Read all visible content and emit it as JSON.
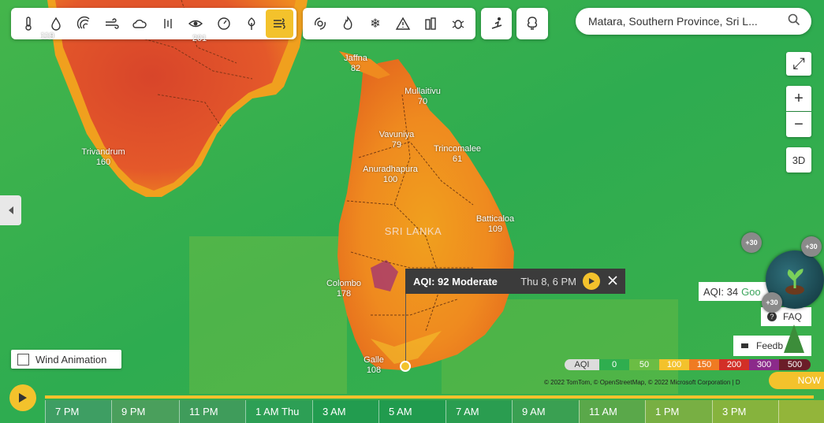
{
  "toolbar": {
    "weather_layers": [
      "thermometer-icon",
      "humidity-drop-icon",
      "wind-swirl-icon",
      "wind-icon",
      "cloud-icon",
      "precipitation-icon",
      "visibility-eye-icon",
      "pressure-gauge-icon",
      "pollen-leaf-icon",
      "air-quality-icon"
    ],
    "active_layer": "air-quality-icon",
    "hazards": [
      "hurricane-icon",
      "wildfire-icon",
      "winter-storm-icon",
      "warning-icon",
      "buildings-icon",
      "bug-icon"
    ]
  },
  "search": {
    "value": "Matara, Southern Province, Sri L..."
  },
  "controls": {
    "expand": "⤢",
    "zoom_in": "+",
    "zoom_out": "−",
    "three_d": "3D"
  },
  "map": {
    "country_label": "SRI LANKA",
    "cities": [
      {
        "name": "",
        "value": "119"
      },
      {
        "name": "",
        "value": "201"
      },
      {
        "name": "Jaffna",
        "value": "82"
      },
      {
        "name": "Mullaitivu",
        "value": "70"
      },
      {
        "name": "Vavuniya",
        "value": "79"
      },
      {
        "name": "Trincomalee",
        "value": "61"
      },
      {
        "name": "Trivandrum",
        "value": "160"
      },
      {
        "name": "Anuradhapura",
        "value": "100"
      },
      {
        "name": "Batticaloa",
        "value": "109"
      },
      {
        "name": "Colombo",
        "value": "178"
      },
      {
        "name": "Galle",
        "value": "108"
      }
    ]
  },
  "popup": {
    "aqi": "AQI: 92 Moderate",
    "time": "Thu 8, 6 PM"
  },
  "wind_animation": {
    "label": "Wind Animation"
  },
  "legend": {
    "title": "AQI",
    "stops": [
      "0",
      "50",
      "100",
      "150",
      "200",
      "300",
      "500"
    ],
    "colors": [
      "#dcdcdc",
      "#2fae4f",
      "#8cc63f",
      "#f3c22c",
      "#ef7b22",
      "#d22f27",
      "#8b2a8a",
      "#6b1d28"
    ]
  },
  "attribution": "© 2022 TomTom, © OpenStreetMap, © 2022 Microsoft Corporation | D",
  "side": {
    "aqi_value": "AQI: 34",
    "aqi_status": "Goo",
    "faq": "FAQ",
    "feedback": "Feedb",
    "bonus": "+30"
  },
  "timeline": {
    "now": "NOW",
    "hours": [
      "7 PM",
      "9 PM",
      "11 PM",
      "1 AM Thu",
      "3 AM",
      "5 AM",
      "7 AM",
      "9 AM",
      "11 AM",
      "1 PM",
      "3 PM",
      ""
    ]
  }
}
